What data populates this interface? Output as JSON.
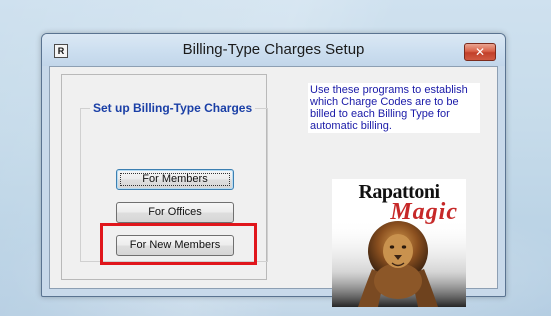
{
  "window": {
    "title": "Billing-Type Charges Setup",
    "icon_letter": "R",
    "close_glyph": "✕"
  },
  "group": {
    "label": "Set up Billing-Type Charges"
  },
  "buttons": {
    "members": "For Members",
    "offices": "For Offices",
    "new_members": "For New Members"
  },
  "info": {
    "text": "Use these programs to establish which Charge Codes are to be billed to each Billing Type for automatic billing."
  },
  "logo": {
    "line1": "Rapattoni",
    "line2": "Magic"
  },
  "colors": {
    "group_label": "#1a3fa6",
    "info_text": "#1a1aa8",
    "highlight_border": "#e0161c",
    "logo_magic": "#c62828"
  },
  "icons": {
    "app": "app-logo-icon",
    "close": "close-icon",
    "logo_image": "lion-image"
  }
}
